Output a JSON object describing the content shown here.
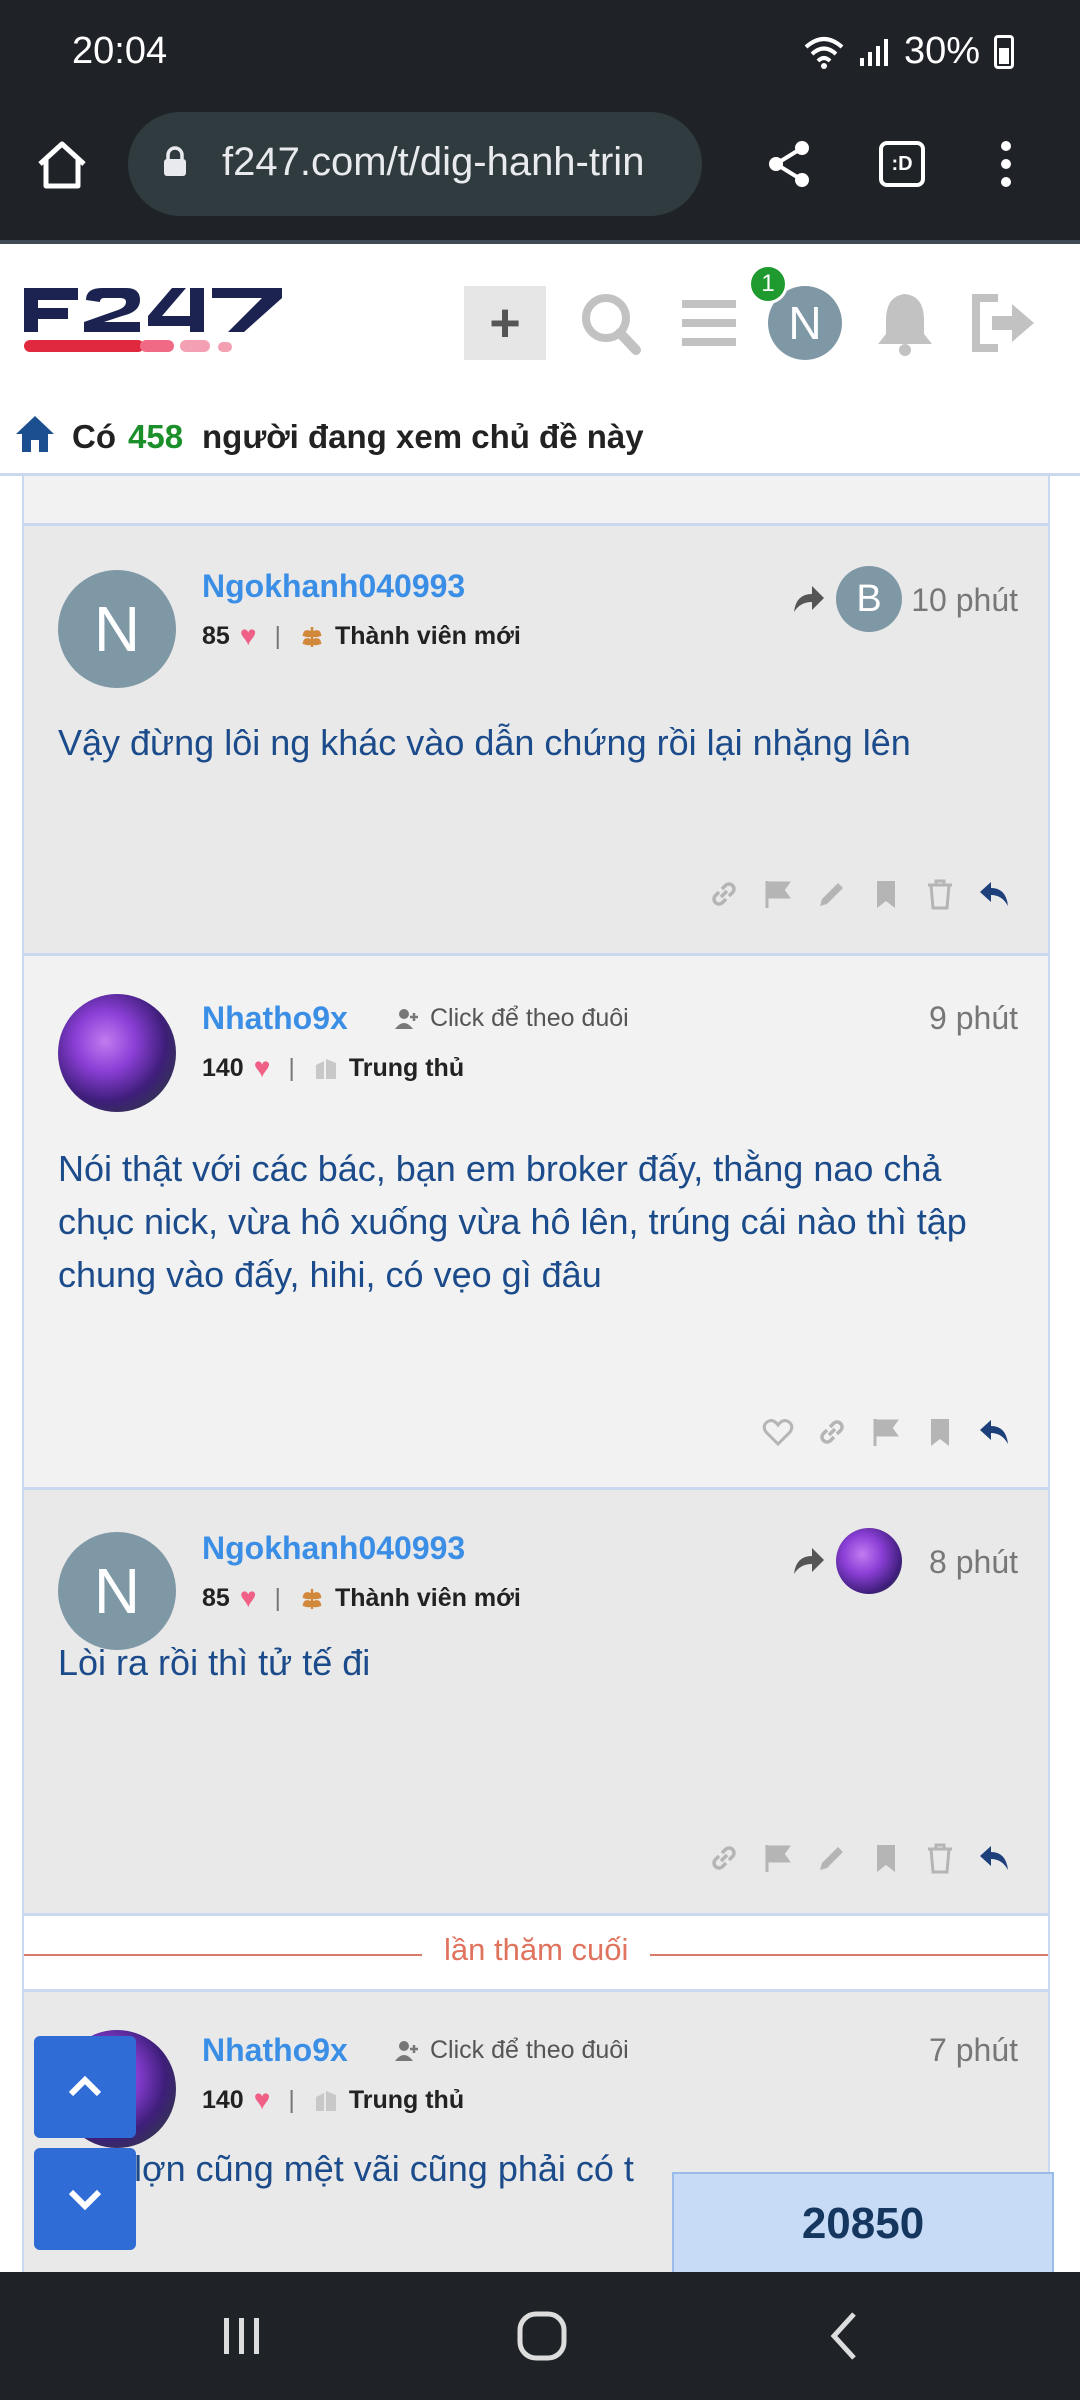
{
  "status_bar": {
    "time": "20:04",
    "battery": "30%"
  },
  "browser": {
    "url": "f247.com/t/dig-hanh-trin",
    "tab_switcher_label": ":D"
  },
  "header": {
    "notification_count": "1",
    "user_initial": "N",
    "plus_label": "+"
  },
  "viewers": {
    "prefix": "Có",
    "count": "458",
    "suffix": "người đang xem chủ đề này"
  },
  "posts": [
    {
      "username": "Ngokhanh040993",
      "avatar_initial": "N",
      "likes": "85",
      "rank": "Thành viên mới",
      "reply_to_initial": "B",
      "time": "10 phút",
      "body": "Vậy đừng lôi ng khác vào dẫn chứng rồi lại nhặng lên"
    },
    {
      "username": "Nhatho9x",
      "follow_label": "Click để theo đuôi",
      "likes": "140",
      "rank": "Trung thủ",
      "time": "9 phút",
      "body": "Nói thật với các bác, bạn em broker đấy, thằng nao chả chục nick, vừa hô xuống vừa hô lên, trúng cái nào thì tập chung vào đấy, hihi, có vẹo gì đâu"
    },
    {
      "username": "Ngokhanh040993",
      "avatar_initial": "N",
      "likes": "85",
      "rank": "Thành viên mới",
      "time": "8 phút",
      "body": "Lòi ra rồi thì tử tế đi"
    },
    {
      "username": "Nhatho9x",
      "follow_label": "Click để theo đuôi",
      "likes": "140",
      "rank": "Trung thủ",
      "time": "7 phút",
      "body": "… n lợn cũng mệt vãi cũng phải có t"
    }
  ],
  "last_visit_label": "lần thăm cuối",
  "post_counter": "20850",
  "colors": {
    "link_blue": "#3b8ee6",
    "body_blue": "#1b4b8a",
    "viewer_green": "#1b8f29",
    "last_visit": "#e0735e"
  }
}
